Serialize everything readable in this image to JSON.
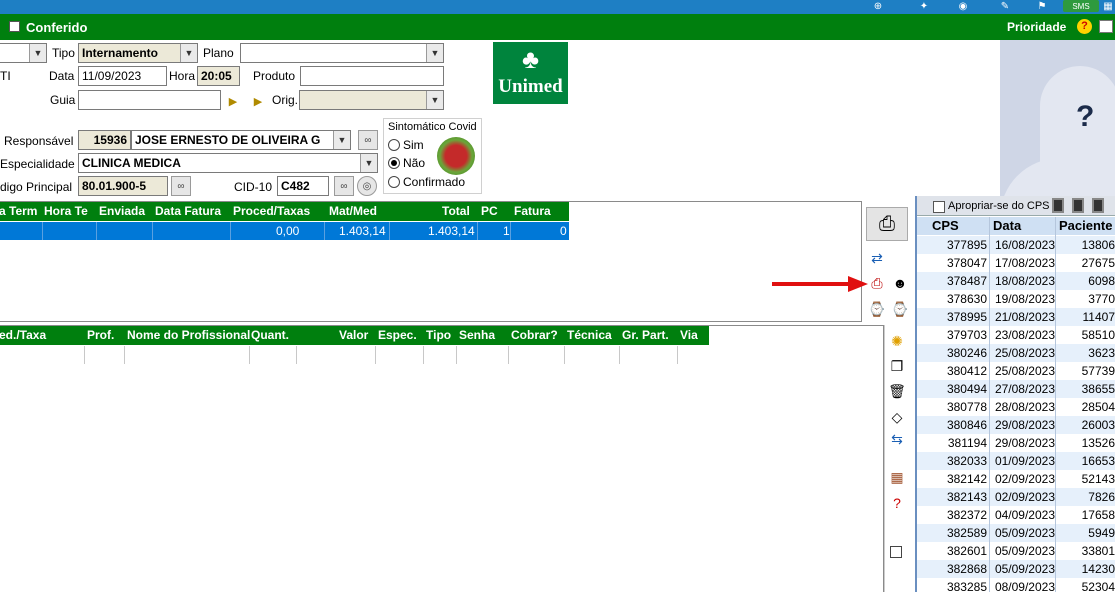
{
  "window": {
    "title": "Conferido",
    "priority_label": "Prioridade",
    "help_symbol": "?"
  },
  "form": {
    "tipo_label": "Tipo",
    "tipo_value": "Internamento",
    "plano_label": "Plano",
    "plano_value": "",
    "row2_left_label": "TI",
    "data_label": "Data",
    "data_value": "11/09/2023",
    "hora_label": "Hora",
    "hora_value": "20:05",
    "produto_label": "Produto",
    "produto_value": "",
    "guia_label": "Guia",
    "guia_value": "",
    "orig_label": "Orig.",
    "orig_value": "",
    "responsavel_label": "Responsável",
    "responsavel_code": "15936",
    "responsavel_name": "JOSE ERNESTO DE OLIVEIRA G",
    "especialidade_label": "Especialidade",
    "especialidade_value": "CLINICA MEDICA",
    "codigo_label": "digo Principal",
    "codigo_value": "80.01.900-5",
    "cid_label": "CID-10",
    "cid_value": "C482"
  },
  "logo": {
    "name": "Unimed",
    "tree": "♣"
  },
  "covid": {
    "title": "Sintomático Covid",
    "options": [
      "Sim",
      "Não",
      "Confirmado"
    ],
    "selected": "Não"
  },
  "upper_grid": {
    "headers": [
      "a Term",
      "Hora Te",
      "Enviada",
      "Data Fatura",
      "Proced/Taxas",
      "Mat/Med",
      "Total",
      "PC",
      "Fatura"
    ],
    "row": [
      "",
      "",
      "",
      "",
      "0,00",
      "1.403,14",
      "1.403,14",
      "1",
      "0"
    ]
  },
  "lower_grid": {
    "headers": [
      "ed./Taxa",
      "Prof.",
      "Nome do Profissional",
      "Quant.",
      "Valor",
      "Espec.",
      "Tipo",
      "Senha",
      "Cobrar?",
      "Técnica",
      "Gr. Part.",
      "Via"
    ]
  },
  "cps_panel": {
    "appropriate_label": "Apropriar-se do CPS",
    "columns": [
      "CPS",
      "Data",
      "Paciente"
    ],
    "rows": [
      [
        "377895",
        "16/08/2023",
        "13806"
      ],
      [
        "378047",
        "17/08/2023",
        "27675"
      ],
      [
        "378487",
        "18/08/2023",
        "6098"
      ],
      [
        "378630",
        "19/08/2023",
        "3770"
      ],
      [
        "378995",
        "21/08/2023",
        "11407"
      ],
      [
        "379703",
        "23/08/2023",
        "58510"
      ],
      [
        "380246",
        "25/08/2023",
        "3623"
      ],
      [
        "380412",
        "25/08/2023",
        "57739"
      ],
      [
        "380494",
        "27/08/2023",
        "38655"
      ],
      [
        "380778",
        "28/08/2023",
        "28504"
      ],
      [
        "380846",
        "29/08/2023",
        "26003"
      ],
      [
        "381194",
        "29/08/2023",
        "13526"
      ],
      [
        "382033",
        "01/09/2023",
        "16653"
      ],
      [
        "382142",
        "02/09/2023",
        "52143"
      ],
      [
        "382143",
        "02/09/2023",
        "7826"
      ],
      [
        "382372",
        "04/09/2023",
        "17658"
      ],
      [
        "382589",
        "05/09/2023",
        "5949"
      ],
      [
        "382601",
        "05/09/2023",
        "33801"
      ],
      [
        "382868",
        "05/09/2023",
        "14230"
      ],
      [
        "383285",
        "08/09/2023",
        "52304"
      ]
    ]
  },
  "topbar_icons": {
    "sms_label": "SMS"
  },
  "colors": {
    "green_header": "#007f0e",
    "selection_blue": "#0078d7",
    "top_blue": "#1e7fc4",
    "unimed_green": "#00843d",
    "arrow_red": "#e01010"
  }
}
